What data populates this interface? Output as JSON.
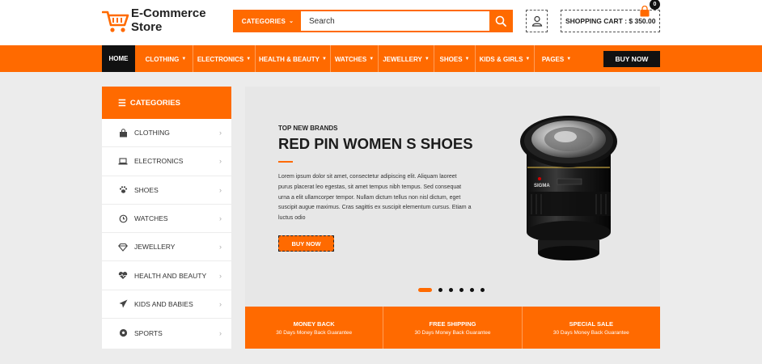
{
  "brand": {
    "line1": "E-Commerce",
    "line2": "Store"
  },
  "search": {
    "category_label": "CATEGORIES",
    "placeholder": "Search"
  },
  "cart": {
    "label": "SHOPPING CART : $ 350.00",
    "count": "0"
  },
  "nav": {
    "items": [
      {
        "label": "HOME"
      },
      {
        "label": "CLOTHING"
      },
      {
        "label": "ELECTRONICS"
      },
      {
        "label": "HEALTH & BEAUTY"
      },
      {
        "label": "WATCHES"
      },
      {
        "label": "JEWELLERY"
      },
      {
        "label": "SHOES"
      },
      {
        "label": "KIDS & GIRLS"
      },
      {
        "label": "PAGES"
      }
    ],
    "buy_now": "BUY NOW"
  },
  "sidebar": {
    "title": "CATEGORIES",
    "items": [
      {
        "label": "CLOTHING",
        "icon": "shopping-bag-icon"
      },
      {
        "label": "ELECTRONICS",
        "icon": "laptop-icon"
      },
      {
        "label": "SHOES",
        "icon": "paw-icon"
      },
      {
        "label": "WATCHES",
        "icon": "clock-icon"
      },
      {
        "label": "JEWELLERY",
        "icon": "diamond-icon"
      },
      {
        "label": "HEALTH AND BEAUTY",
        "icon": "heartbeat-icon"
      },
      {
        "label": "KIDS AND BABIES",
        "icon": "paper-plane-icon"
      },
      {
        "label": "SPORTS",
        "icon": "soccer-ball-icon"
      }
    ]
  },
  "banner": {
    "kicker": "TOP NEW BRANDS",
    "headline": "RED PIN WOMEN S SHOES",
    "description": "Lorem ipsum dolor sit amet, consectetur adipiscing elit. Aliquam laoreet purus placerat leo egestas, sit amet tempus nibh tempus. Sed consequat urna a elit ullamcorper tempor. Nullam dictum tellus non nisl dictum, eget suscipit augue maximus. Cras sagittis ex suscipit elementum cursus. Etiam a luctus odio",
    "button": "BUY NOW",
    "lens_brand": "SIGMA",
    "slides": 6,
    "active_slide": 1
  },
  "features": [
    {
      "title": "MONEY BACK",
      "subtitle": "30 Days Money Back Guarantee"
    },
    {
      "title": "FREE SHIPPING",
      "subtitle": "30 Days Money Back Guarantee"
    },
    {
      "title": "SPECIAL SALE",
      "subtitle": "30 Days Money Back Guarantee"
    }
  ],
  "colors": {
    "accent": "#ff6a00",
    "dark": "#111111",
    "background": "#ececec"
  }
}
